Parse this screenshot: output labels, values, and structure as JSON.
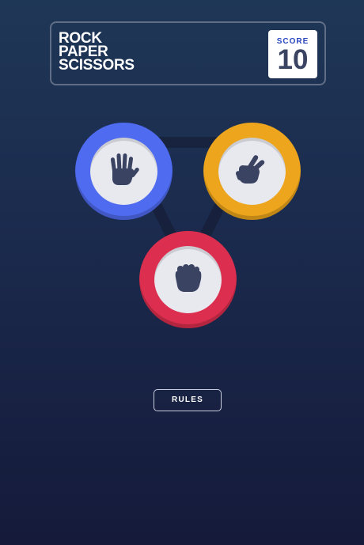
{
  "header": {
    "title_lines": [
      "ROCK",
      "PAPER",
      "SCISSORS"
    ],
    "score_label": "SCORE",
    "score_value": "10"
  },
  "choices": [
    {
      "id": "paper",
      "icon": "paper-hand-icon",
      "color": "#4f6bf0"
    },
    {
      "id": "scissors",
      "icon": "scissors-hand-icon",
      "color": "#eca51c"
    },
    {
      "id": "rock",
      "icon": "rock-fist-icon",
      "color": "#dc2e4e"
    }
  ],
  "rules_button_label": "RULES",
  "colors": {
    "background_top": "#1f3757",
    "background_bottom": "#151a3a",
    "score_label": "#2a46c0",
    "score_value": "#3b4363",
    "icon": "#3b4363"
  }
}
